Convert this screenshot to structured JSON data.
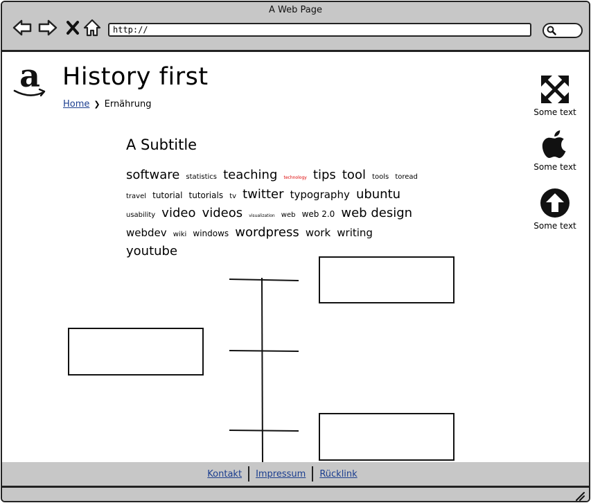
{
  "window": {
    "title": "A Web Page"
  },
  "browser": {
    "url": "http://"
  },
  "header": {
    "title": "History first",
    "breadcrumb": {
      "home": "Home",
      "current": "Ernährung"
    }
  },
  "sidebar": {
    "items": [
      {
        "label": "Some text",
        "icon": "expand-arrows-icon"
      },
      {
        "label": "Some text",
        "icon": "apple-icon"
      },
      {
        "label": "Some text",
        "icon": "arrow-up-circle-icon"
      }
    ]
  },
  "content": {
    "subtitle": "A Subtitle",
    "tags": [
      {
        "text": "software",
        "size": "xl"
      },
      {
        "text": "statistics",
        "size": "s"
      },
      {
        "text": "teaching",
        "size": "xl"
      },
      {
        "text": "technology",
        "size": "xs",
        "color": "#dd0000"
      },
      {
        "text": "tips",
        "size": "xl"
      },
      {
        "text": "tool",
        "size": "xl"
      },
      {
        "text": "tools",
        "size": "s"
      },
      {
        "text": "toread",
        "size": "s"
      },
      {
        "text": "travel",
        "size": "s"
      },
      {
        "text": "tutorial",
        "size": "m"
      },
      {
        "text": "tutorials",
        "size": "m"
      },
      {
        "text": "tv",
        "size": "s"
      },
      {
        "text": "twitter",
        "size": "xl"
      },
      {
        "text": "typography",
        "size": "l"
      },
      {
        "text": "ubuntu",
        "size": "xl"
      },
      {
        "text": "usability",
        "size": "s"
      },
      {
        "text": "video",
        "size": "xl"
      },
      {
        "text": "videos",
        "size": "xl"
      },
      {
        "text": "visualization",
        "size": "xs"
      },
      {
        "text": "web",
        "size": "s"
      },
      {
        "text": "web 2.0",
        "size": "m"
      },
      {
        "text": "web design",
        "size": "xl"
      },
      {
        "text": "webdev",
        "size": "l"
      },
      {
        "text": "wiki",
        "size": "s"
      },
      {
        "text": "windows",
        "size": "m"
      },
      {
        "text": "wordpress",
        "size": "xl"
      },
      {
        "text": "work",
        "size": "l"
      },
      {
        "text": "writing",
        "size": "l"
      },
      {
        "text": "youtube",
        "size": "xl"
      }
    ]
  },
  "footer": {
    "links": [
      "Kontakt",
      "Impressum",
      "Rücklink"
    ]
  },
  "colors": {
    "chrome": "#c7c7c7",
    "link": "#1a3d8f",
    "border": "#222222"
  }
}
